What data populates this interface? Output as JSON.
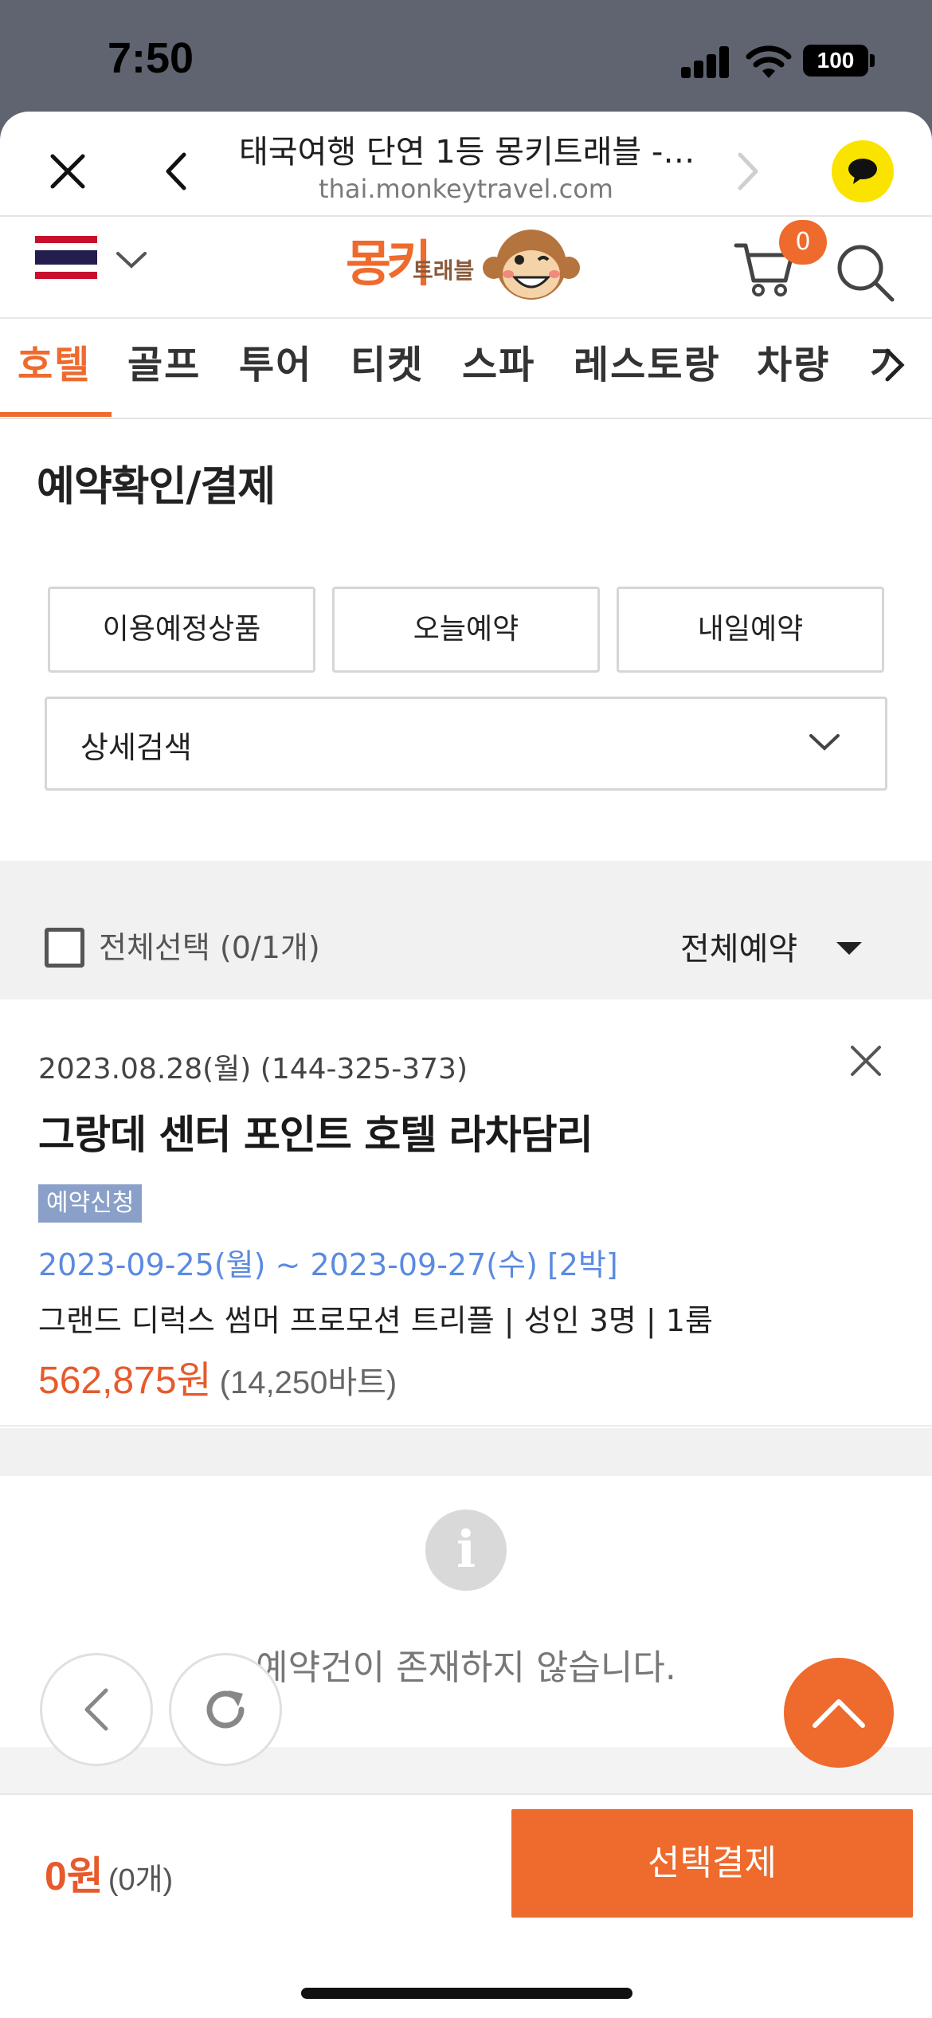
{
  "status_bar": {
    "time": "7:50",
    "battery": "100"
  },
  "browser": {
    "page_title": "태국여행 단연 1등 몽키트래블 -…",
    "url": "thai.monkeytravel.com"
  },
  "site_header": {
    "logo_main": "몽키",
    "logo_sub": "트래블",
    "cart_count": "0"
  },
  "tabs": [
    {
      "label": "호텔",
      "active": true
    },
    {
      "label": "골프"
    },
    {
      "label": "투어"
    },
    {
      "label": "티켓"
    },
    {
      "label": "스파"
    },
    {
      "label": "레스토랑"
    },
    {
      "label": "차량"
    },
    {
      "label": "가"
    }
  ],
  "main": {
    "title": "예약확인/결제",
    "filters": [
      "이용예정상품",
      "오늘예약",
      "내일예약"
    ],
    "detail_search": "상세검색",
    "select_all": "전체선택 (0/1개)",
    "reservation_filter": "전체예약"
  },
  "reservation": {
    "date_and_id": "2023.08.28(월) (144-325-373)",
    "hotel_name": "그랑데 센터 포인트 호텔 라차담리",
    "status": "예약신청",
    "stay_dates": "2023-09-25(월) ~ 2023-09-27(수) [2박]",
    "room_info": "그랜드 디럭스 썸머 프로모션 트리플 | 성인 3명 | 1룸",
    "price": "562,875원",
    "price_local": "(14,250바트)"
  },
  "empty_state": {
    "icon_glyph": "i",
    "message": "예약건이 존재하지 않습니다."
  },
  "bottom_bar": {
    "total": "0원",
    "count": "(0개)",
    "pay_label": "선택결제"
  },
  "colors": {
    "accent": "#ee6a2d",
    "link_blue": "#5b8ae0",
    "badge": "#8aa0c8",
    "kakao": "#fbe300"
  }
}
